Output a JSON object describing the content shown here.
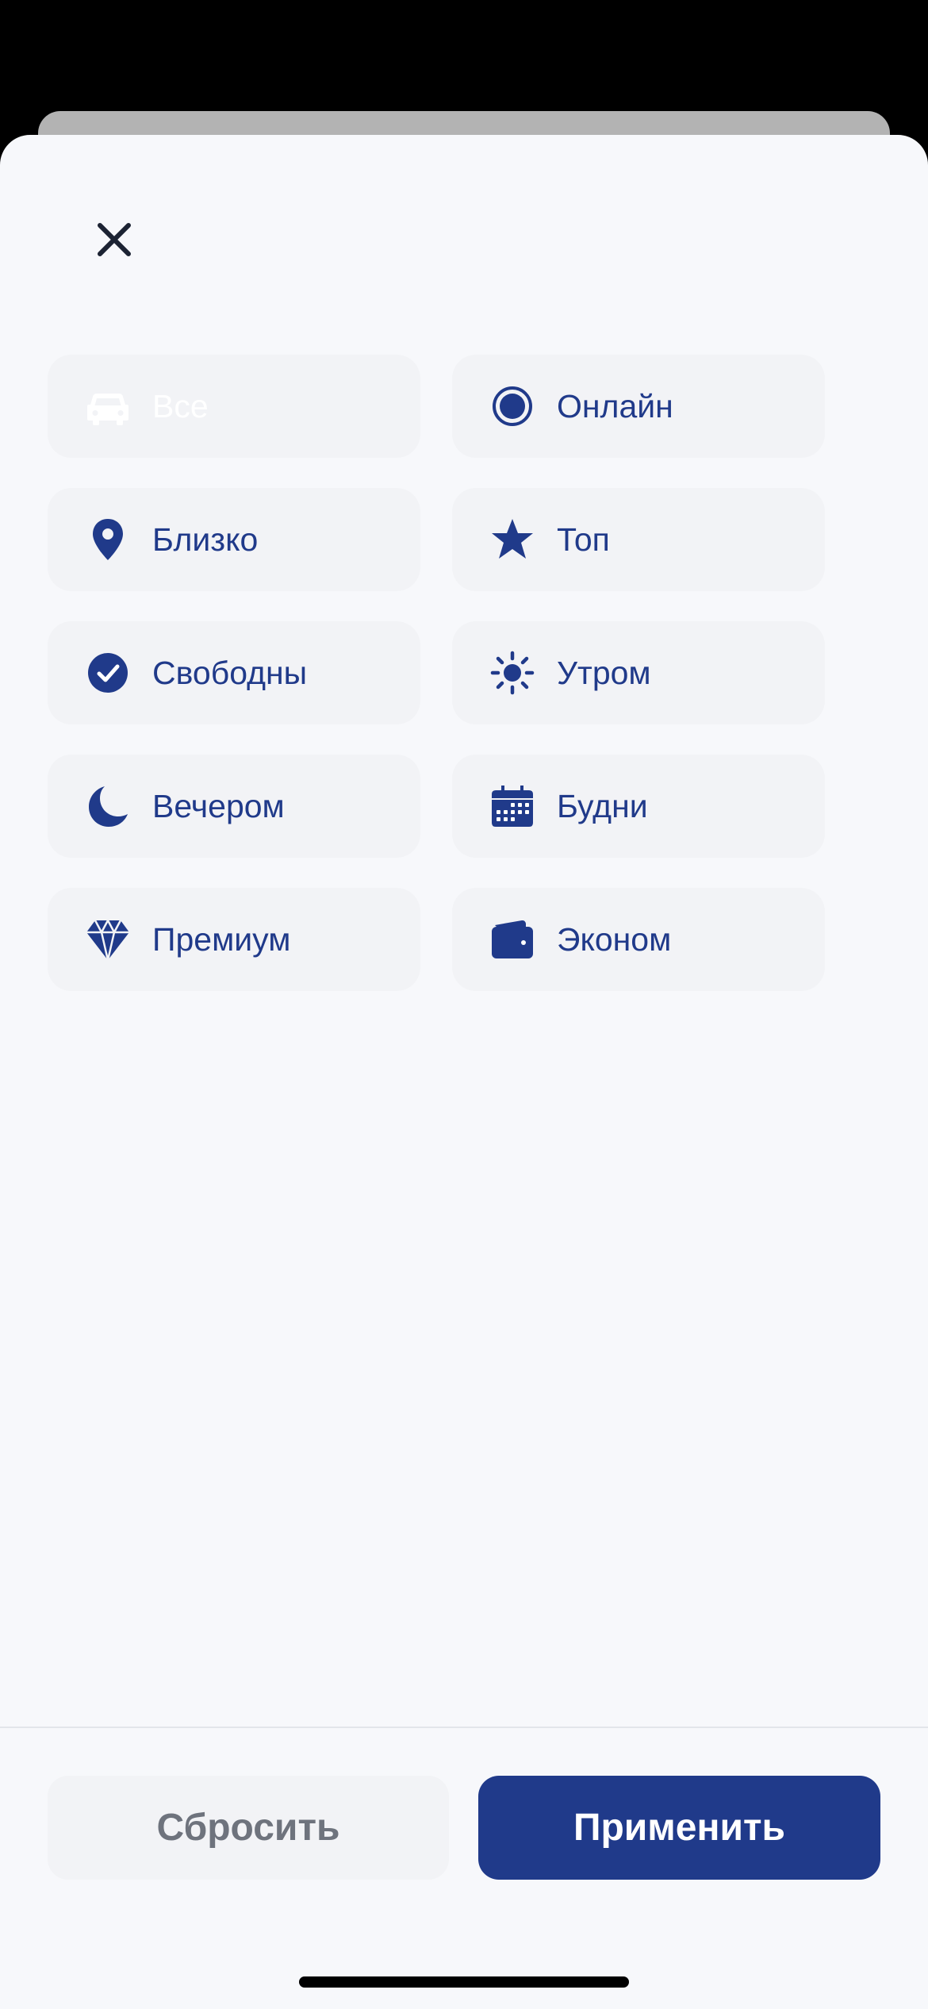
{
  "filters": {
    "all": "Все",
    "online": "Онлайн",
    "near": "Близко",
    "top": "Топ",
    "free": "Свободны",
    "morning": "Утром",
    "evening": "Вечером",
    "weekdays": "Будни",
    "premium": "Премиум",
    "economy": "Эконом"
  },
  "icons": {
    "all": "car-icon",
    "online": "radio-dot-icon",
    "near": "map-pin-icon",
    "top": "star-icon",
    "free": "check-circle-icon",
    "morning": "sun-icon",
    "evening": "moon-icon",
    "weekdays": "calendar-icon",
    "premium": "diamond-icon",
    "economy": "wallet-icon"
  },
  "footer": {
    "reset_label": "Сбросить",
    "apply_label": "Применить"
  },
  "colors": {
    "accent": "#203a8a",
    "sheet_background": "#f7f8fb",
    "chip_background": "#f2f3f6",
    "reset_text": "#6e737d"
  }
}
